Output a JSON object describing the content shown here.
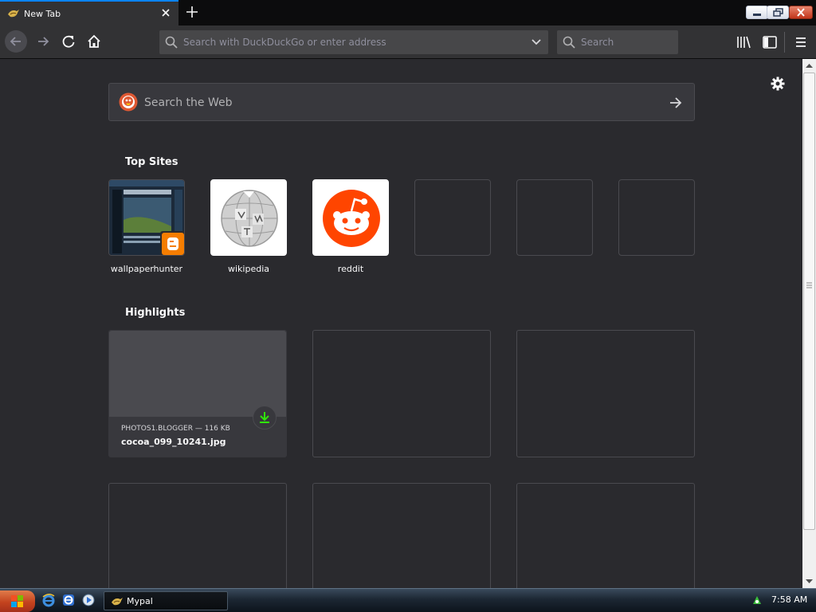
{
  "browser": {
    "tab_title": "New Tab",
    "url_placeholder": "Search with DuckDuckGo or enter address",
    "search_placeholder": "Search"
  },
  "newtab": {
    "web_search_placeholder": "Search the Web",
    "top_sites_title": "Top Sites",
    "highlights_title": "Highlights",
    "top_sites": [
      {
        "label": "wallpaperhunter",
        "icon": "blogger-icon"
      },
      {
        "label": "wikipedia",
        "icon": "wikipedia-globe-icon"
      },
      {
        "label": "reddit",
        "icon": "reddit-alien-icon"
      }
    ],
    "highlight": {
      "source": "PHOTOS1.BLOGGER — 116 KB",
      "filename": "cocoa_099_10241.jpg"
    }
  },
  "taskbar": {
    "task_label": "Mypal",
    "clock": "7:58 AM"
  },
  "colors": {
    "accent": "#0a84ff",
    "background": "#2a2a2e",
    "toolbar": "#323234",
    "reddit": "#ff4500",
    "blogger": "#f57d00",
    "download_green": "#30e60b"
  }
}
